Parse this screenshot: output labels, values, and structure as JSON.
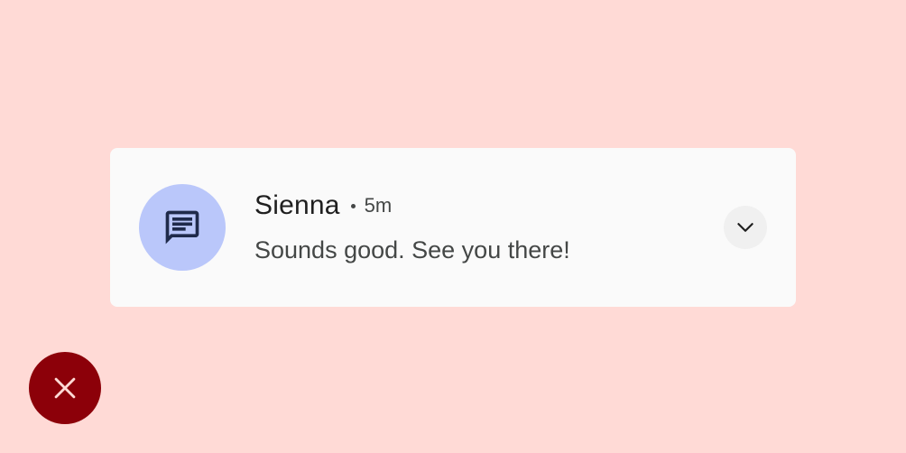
{
  "notification": {
    "sender": "Sienna",
    "separator": "•",
    "time": "5m",
    "message": "Sounds good. See you there!",
    "icon": "chat-message-icon",
    "expand_icon": "chevron-down-icon"
  },
  "dismiss": {
    "icon": "close-icon"
  },
  "colors": {
    "background": "#FFDAD6",
    "card": "#FAFAFA",
    "avatar": "#BAC7FA",
    "icon": "#1F2A4A",
    "sender_text": "#1F1F1F",
    "secondary_text": "#444746",
    "expand_button": "#F0F0F0",
    "close_button": "#8C0009",
    "close_icon": "#FFDAD6"
  }
}
